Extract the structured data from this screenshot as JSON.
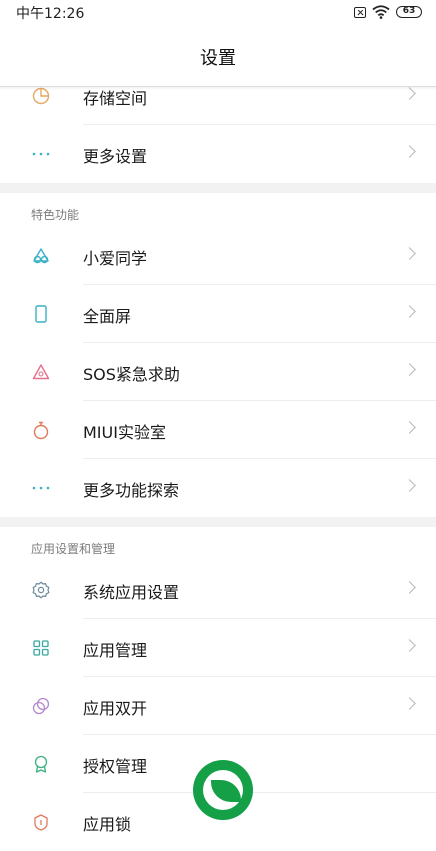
{
  "status_bar": {
    "time": "中午12:26",
    "battery": "63"
  },
  "header": {
    "title": "设置"
  },
  "group1": [
    {
      "label": "存储空间",
      "icon": "storage-pie-icon",
      "color": "#e8a564"
    },
    {
      "label": "更多设置",
      "icon": "more-dots-icon",
      "color": "#3ab0c6"
    }
  ],
  "section_features": {
    "title": "特色功能",
    "items": [
      {
        "label": "小爱同学",
        "icon": "xiaoai-icon",
        "color": "#3ab0c6"
      },
      {
        "label": "全面屏",
        "icon": "fullscreen-phone-icon",
        "color": "#3ab0c6"
      },
      {
        "label": "SOS紧急求助",
        "icon": "sos-warning-icon",
        "color": "#e5708c"
      },
      {
        "label": "MIUI实验室",
        "icon": "lab-flask-icon",
        "color": "#e07a5a"
      },
      {
        "label": "更多功能探索",
        "icon": "more-dots-icon",
        "color": "#3ab0c6"
      }
    ]
  },
  "section_apps": {
    "title": "应用设置和管理",
    "items": [
      {
        "label": "系统应用设置",
        "icon": "gear-icon",
        "color": "#6b8a9a"
      },
      {
        "label": "应用管理",
        "icon": "grid-apps-icon",
        "color": "#3aa8a0"
      },
      {
        "label": "应用双开",
        "icon": "dual-app-icon",
        "color": "#b58ad0"
      },
      {
        "label": "授权管理",
        "icon": "authorization-badge-icon",
        "color": "#3ab080"
      },
      {
        "label": "应用锁",
        "icon": "app-lock-icon",
        "color": "#e07a5a"
      }
    ]
  }
}
